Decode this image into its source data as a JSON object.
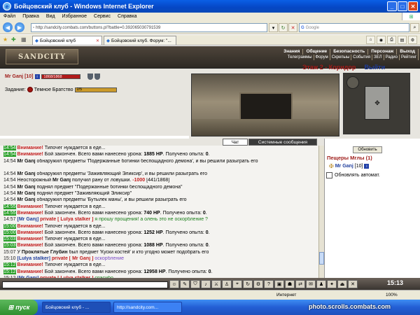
{
  "window": {
    "title": "Бойцовский клуб - Windows Internet Explorer",
    "icon": "ie-icon"
  },
  "menu": [
    "Файл",
    "Правка",
    "Вид",
    "Избранное",
    "Сервис",
    "Справка"
  ],
  "address": {
    "url": "http://sandcity.combats.com/buttons.pl?battle=0.392065030791539",
    "search_placeholder": "Google"
  },
  "tabs": [
    {
      "label": "Бойцовский клуб",
      "active": true
    },
    {
      "label": "Бойцовский клуб. Форум: \"...",
      "active": false
    }
  ],
  "game": {
    "logo": "SANDCITY",
    "nav_top": [
      "Знания",
      "Общение",
      "Безопасность",
      "Персонаж",
      "Выход"
    ],
    "nav_bottom": [
      "Телеграммы",
      "Форум",
      "Скрепыы",
      "События",
      "ЗЕЛ",
      "Радио",
      "Рейтинг"
    ],
    "player": {
      "nick": "Mr Ganj",
      "level": "[10]",
      "hp": "1868/1868"
    },
    "task": {
      "label": "Задание:",
      "name": "Темное Братство",
      "progress_text": "2/5"
    },
    "location": {
      "title": "Этаж 2 - Коридор",
      "exit": "Выйти"
    }
  },
  "chat": {
    "tabs": [
      "Чат",
      "Системные сообщения"
    ],
    "messages": [
      {
        "time": "14:54",
        "green": true,
        "parts": [
          [
            "warn",
            "Внимание!"
          ],
          [
            "",
            " Типочег нуждается в еде..."
          ]
        ]
      },
      {
        "time": "14:54",
        "green": true,
        "parts": [
          [
            "warn",
            "Внимание!"
          ],
          [
            "",
            " Бой закончен. Всего вами нанесено урона: "
          ],
          [
            "num",
            "1885 HP"
          ],
          [
            "",
            ". Получено опыта: "
          ],
          [
            "num",
            "0"
          ],
          [
            "",
            "."
          ]
        ]
      },
      {
        "time": "14:54",
        "green": false,
        "two": true,
        "parts": [
          [
            "who",
            "Mr Ganj"
          ],
          [
            "",
            " обнаружил предметы 'Подержанные ботинки беспощадного демона', и вы решили разыграть его"
          ]
        ]
      },
      {
        "time": "14:54",
        "green": false,
        "parts": [
          [
            "who",
            "Mr Ganj"
          ],
          [
            "",
            " обнаружил предметы 'Заживляющий Эликсир', и вы решили разыграть его"
          ]
        ]
      },
      {
        "time": "14:54",
        "green": false,
        "parts": [
          [
            "",
            "Неосторожный "
          ],
          [
            "who",
            "Mr Ganj"
          ],
          [
            "",
            " получил рану от ловушки. "
          ],
          [
            "dmg",
            "-1000"
          ],
          [
            "",
            " [441/1868]"
          ]
        ]
      },
      {
        "time": "14:54",
        "green": false,
        "parts": [
          [
            "who",
            "Mr Ganj"
          ],
          [
            "",
            " поднял предмет \"Подержанные ботинки беспощадного демона\""
          ]
        ]
      },
      {
        "time": "14:54",
        "green": false,
        "parts": [
          [
            "who",
            "Mr Ganj"
          ],
          [
            "",
            " поднял предмет \"Заживляющий Эликсир\""
          ]
        ]
      },
      {
        "time": "14:54",
        "green": false,
        "parts": [
          [
            "who",
            "Mr Ganj"
          ],
          [
            "",
            " обнаружил предметы 'Бутылек маны', и вы решили разыграть его"
          ]
        ]
      },
      {
        "time": "14:55",
        "green": true,
        "parts": [
          [
            "warn",
            "Внимание!"
          ],
          [
            "",
            " Типочег нуждается в еде..."
          ]
        ]
      },
      {
        "time": "14:55",
        "green": true,
        "parts": [
          [
            "warn",
            "Внимание!"
          ],
          [
            "",
            " Бой закончен. Всего вами нанесено урона: "
          ],
          [
            "num",
            "740 HP"
          ],
          [
            "",
            ". Получено опыта: "
          ],
          [
            "num",
            "0"
          ],
          [
            "",
            "."
          ]
        ]
      },
      {
        "time": "14:57",
        "green": false,
        "parts": [
          [
            "blue",
            "[Mr Ganj]"
          ],
          [
            "priv",
            " private [ Lulya stalker ]"
          ],
          [
            "pmsg",
            " я прошу прощения! а олень это не оскорбление ?"
          ]
        ]
      },
      {
        "time": "15:00",
        "green": true,
        "parts": [
          [
            "warn",
            "Внимание!"
          ],
          [
            "",
            " Типочег нуждается в еде..."
          ]
        ]
      },
      {
        "time": "15:00",
        "green": true,
        "parts": [
          [
            "warn",
            "Внимание!"
          ],
          [
            "",
            " Бой закончен. Всего вами нанесено урона: "
          ],
          [
            "num",
            "1252 HP"
          ],
          [
            "",
            ". Получено опыта: "
          ],
          [
            "num",
            "0"
          ],
          [
            "",
            "."
          ]
        ]
      },
      {
        "time": "15:03",
        "green": true,
        "parts": [
          [
            "warn",
            "Внимание!"
          ],
          [
            "",
            " Типочег нуждается в еде..."
          ]
        ]
      },
      {
        "time": "15:03",
        "green": true,
        "parts": [
          [
            "warn",
            "Внимание!"
          ],
          [
            "",
            " Бой закончен. Всего вами нанесено урона: "
          ],
          [
            "num",
            "1088 HP"
          ],
          [
            "",
            ". Получено опыта: "
          ],
          [
            "num",
            "0"
          ],
          [
            "",
            "."
          ]
        ]
      },
      {
        "time": "15:07",
        "green": false,
        "parts": [
          [
            "",
            "У "
          ],
          [
            "who",
            "Проклятые Глубин"
          ],
          [
            "",
            " был предмет 'Куски костей' и кто угодно может подобрать его"
          ]
        ]
      },
      {
        "time": "15:10",
        "green": false,
        "parts": [
          [
            "blue",
            "[Lulya stalker]"
          ],
          [
            "priv",
            " private [ Mr Ganj ]"
          ],
          [
            "badword",
            " оскорбление"
          ]
        ]
      },
      {
        "time": "15:12",
        "green": true,
        "parts": [
          [
            "warn",
            "Внимание!"
          ],
          [
            "",
            " Типочег нуждается в еде..."
          ]
        ]
      },
      {
        "time": "15:12",
        "green": true,
        "parts": [
          [
            "warn",
            "Внимание!"
          ],
          [
            "",
            " Бой закончен. Всего вами нанесено урона: "
          ],
          [
            "num",
            "12958 HP"
          ],
          [
            "",
            ". Получено опыта: "
          ],
          [
            "num",
            "0"
          ],
          [
            "",
            "."
          ]
        ]
      },
      {
        "time": "15:12",
        "green": false,
        "parts": [
          [
            "blue",
            "[Mr Ganj]"
          ],
          [
            "priv",
            " private [ Lulya stalker ]"
          ],
          [
            "pmsg",
            " спасибо"
          ]
        ]
      }
    ]
  },
  "room": {
    "refresh_label": "Обновить",
    "title": "Пещеры Мглы (1)",
    "user": "Mr Ganj",
    "user_level": "[10]",
    "auto_refresh_label": "Обновлять автомат."
  },
  "clock": "15:13",
  "status": {
    "zone": "Интернет",
    "zoom": "100%"
  },
  "taskbar": {
    "start": "пуск",
    "tasks": [
      "Бойцовский клуб - ...",
      "http://sandcity.com..."
    ],
    "watermark": "photo.scrolls.combats.com"
  }
}
